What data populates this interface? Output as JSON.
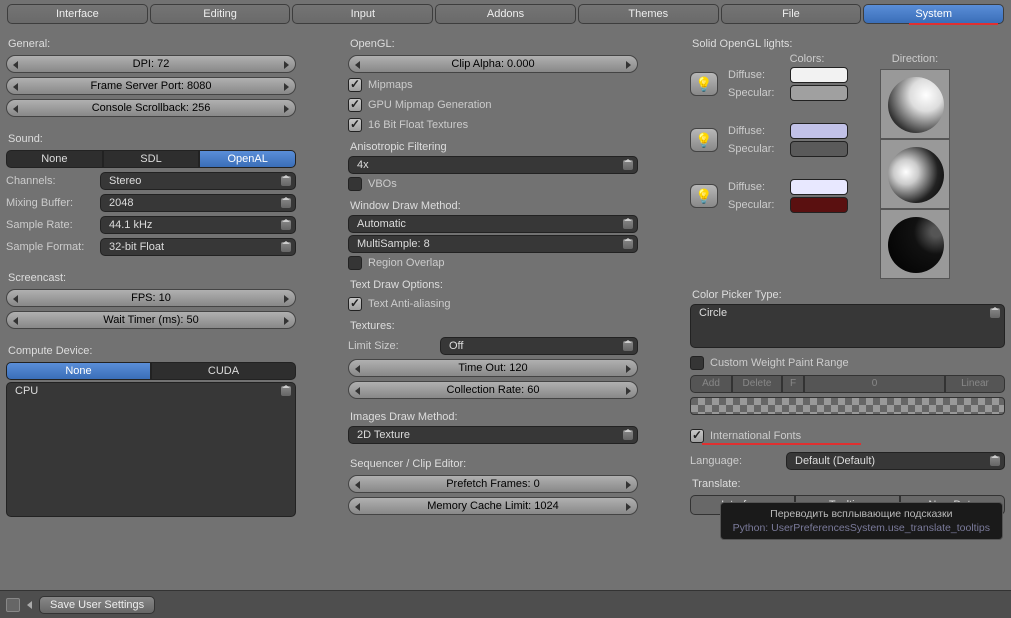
{
  "tabs": [
    "Interface",
    "Editing",
    "Input",
    "Addons",
    "Themes",
    "File",
    "System"
  ],
  "active_tab": 6,
  "general": {
    "h": "General:",
    "dpi": "DPI: 72",
    "port": "Frame Server Port: 8080",
    "scroll": "Console Scrollback: 256"
  },
  "sound": {
    "h": "Sound:",
    "opts": [
      "None",
      "SDL",
      "OpenAL"
    ],
    "sel": 2,
    "channels_l": "Channels:",
    "channels": "Stereo",
    "mix_l": "Mixing Buffer:",
    "mix": "2048",
    "rate_l": "Sample Rate:",
    "rate": "44.1 kHz",
    "fmt_l": "Sample Format:",
    "fmt": "32-bit Float"
  },
  "screencast": {
    "h": "Screencast:",
    "fps": "FPS: 10",
    "wait": "Wait Timer (ms): 50"
  },
  "compute": {
    "h": "Compute Device:",
    "opts": [
      "None",
      "CUDA"
    ],
    "sel": 0,
    "dev": "CPU"
  },
  "opengl": {
    "h": "OpenGL:",
    "clip": "Clip Alpha: 0.000",
    "mip": "Mipmaps",
    "gpu": "GPU Mipmap Generation",
    "f16": "16 Bit Float Textures",
    "aniso_l": "Anisotropic Filtering",
    "aniso": "4x",
    "vbo": "VBOs",
    "wdm_l": "Window Draw Method:",
    "wdm": "Automatic",
    "ms": "MultiSample: 8",
    "overlap": "Region Overlap",
    "tdo_l": "Text Draw Options:",
    "taa": "Text Anti-aliasing",
    "tex_l": "Textures:",
    "limit_l": "Limit Size:",
    "limit": "Off",
    "timeout": "Time Out: 120",
    "collect": "Collection Rate: 60",
    "idm_l": "Images Draw Method:",
    "idm": "2D Texture",
    "seq_l": "Sequencer / Clip Editor:",
    "prefetch": "Prefetch Frames: 0",
    "memcache": "Memory Cache Limit: 1024"
  },
  "lights": {
    "h": "Solid OpenGL lights:",
    "colors_l": "Colors:",
    "dir_l": "Direction:",
    "diff_l": "Diffuse:",
    "spec_l": "Specular:",
    "items": [
      {
        "diff": "#f2f2f2",
        "spec": "#a0a0a0"
      },
      {
        "diff": "#c2c2e8",
        "spec": "#5a5a5a"
      },
      {
        "diff": "#e8e8ff",
        "spec": "#5a1010"
      }
    ]
  },
  "picker": {
    "h": "Color Picker Type:",
    "v": "Circle"
  },
  "cwp": {
    "l": "Custom Weight Paint Range",
    "add": "Add",
    "del": "Delete",
    "f": "F",
    "num": "0",
    "lin": "Linear"
  },
  "intl": {
    "l": "International Fonts",
    "lang_l": "Language:",
    "lang": "Default (Default)",
    "tr_l": "Translate:",
    "b1": "Interface",
    "b2": "Tooltips",
    "b3": "New Data"
  },
  "tooltip": {
    "l1": "Переводить всплывающие подсказки",
    "l2": "Python: UserPreferencesSystem.use_translate_tooltips"
  },
  "footer": {
    "save": "Save User Settings"
  }
}
